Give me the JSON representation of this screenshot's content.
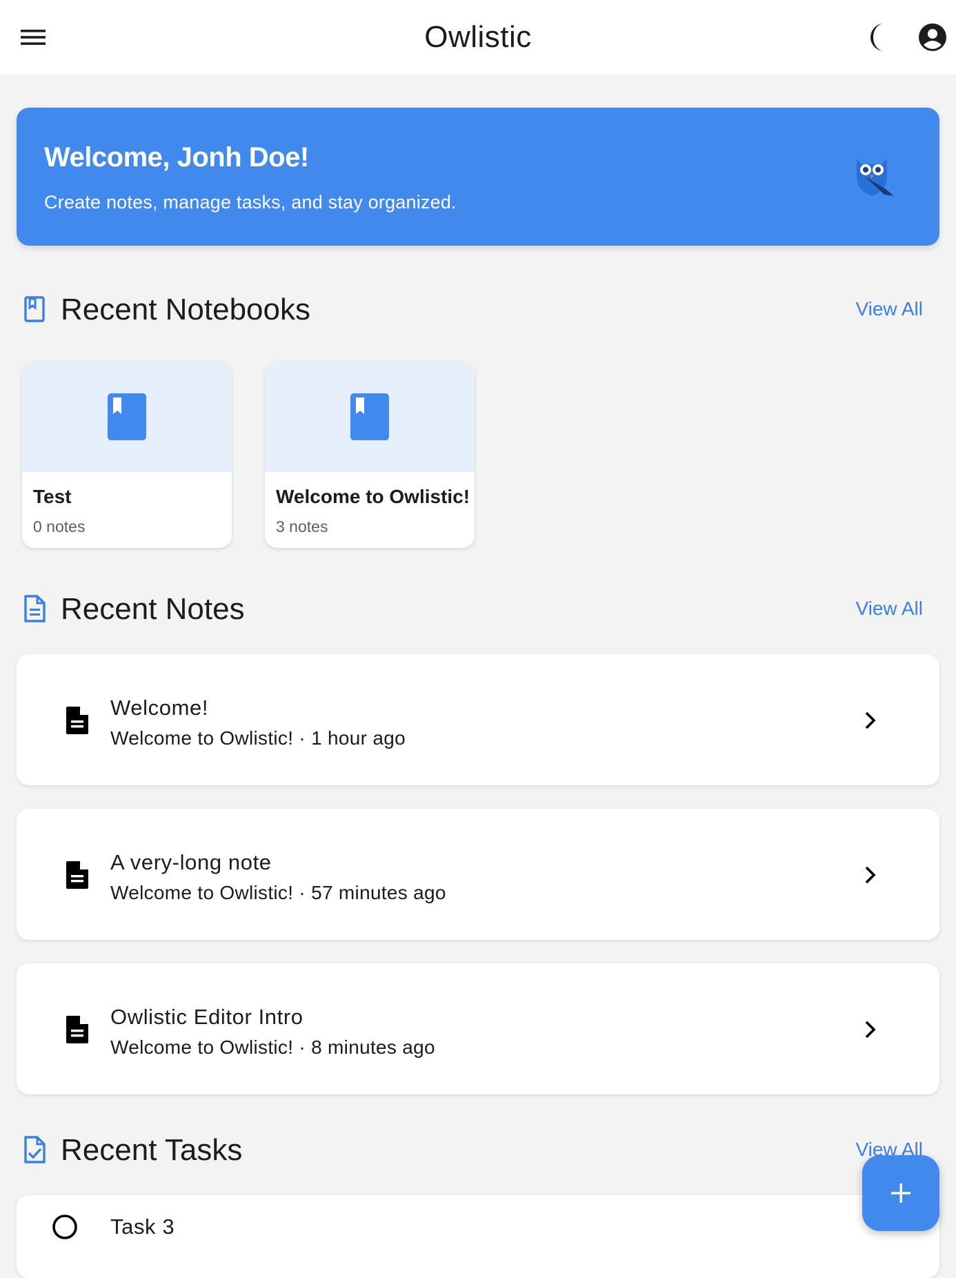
{
  "app_bar": {
    "title": "Owlistic",
    "icons": [
      "menu-icon",
      "dark-mode-moon-icon",
      "account-circle-icon"
    ]
  },
  "welcome": {
    "heading": "Welcome, Jonh Doe!",
    "subtitle": "Create notes, manage tasks, and stay organized.",
    "icon": "owl-logo-icon",
    "color": "#4189ec"
  },
  "sections": {
    "notebooks": {
      "title": "Recent Notebooks",
      "view_all": "View All",
      "icon": "notebook-icon"
    },
    "notes": {
      "title": "Recent Notes",
      "view_all": "View All",
      "icon": "note-icon"
    },
    "tasks": {
      "title": "Recent Tasks",
      "view_all": "View All",
      "icon": "task-icon"
    }
  },
  "notebooks": [
    {
      "name": "Test",
      "count": "0 notes",
      "icon": "book-icon"
    },
    {
      "name": "Welcome to Owlistic!",
      "count": "3 notes",
      "icon": "book-icon"
    }
  ],
  "notes": [
    {
      "title": "Welcome!",
      "subtitle": "Welcome to Owlistic! · 1 hour ago",
      "icon": "document-icon"
    },
    {
      "title": "A very-long note",
      "subtitle": "Welcome to Owlistic! · 57 minutes ago",
      "icon": "document-icon"
    },
    {
      "title": "Owlistic Editor Intro",
      "subtitle": "Welcome to Owlistic! · 8 minutes ago",
      "icon": "document-icon"
    }
  ],
  "tasks": [
    {
      "title": "Task 3",
      "completed": false
    }
  ],
  "fab": {
    "icon": "plus-icon"
  },
  "colors": {
    "accent": "#4189ec",
    "link": "#3b7fe0",
    "card_cover": "#e6f0fd",
    "background": "#f3f3f3"
  }
}
